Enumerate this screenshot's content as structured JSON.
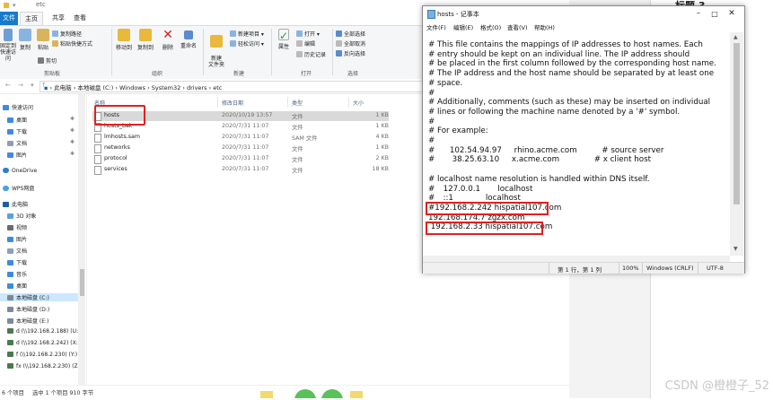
{
  "explorer": {
    "title": "etc",
    "tabs": [
      "文件",
      "主页",
      "共享",
      "查看"
    ],
    "ribbon": {
      "pin_label": "固定到快速访问",
      "copy": "复制",
      "paste": "粘贴",
      "copy_path": "复制路径",
      "paste_shortcut": "粘贴快捷方式",
      "cut": "剪切",
      "move_to": "移动到",
      "copy_to": "复制到",
      "delete": "删除",
      "rename": "重命名",
      "new_folder": "新建\n文件夹",
      "new_item": "新建项目",
      "easy_access": "轻松访问",
      "properties": "属性",
      "open": "打开",
      "edit": "编辑",
      "history": "历史记录",
      "select_all": "全部选择",
      "select_none": "全部取消",
      "invert_select": "反向选择",
      "groups": [
        "剪贴板",
        "组织",
        "新建",
        "打开",
        "选择"
      ]
    },
    "breadcrumbs": [
      "此电脑",
      "本地磁盘 (C:)",
      "Windows",
      "System32",
      "drivers",
      "etc"
    ],
    "nav": [
      {
        "label": "快速访问"
      },
      {
        "label": "桌面"
      },
      {
        "label": "下载"
      },
      {
        "label": "文档"
      },
      {
        "label": "图片"
      },
      {
        "label": "OneDrive"
      },
      {
        "label": "WPS网盘"
      },
      {
        "label": "此电脑"
      },
      {
        "label": "3D 对象"
      },
      {
        "label": "视频"
      },
      {
        "label": "图片"
      },
      {
        "label": "文档"
      },
      {
        "label": "下载"
      },
      {
        "label": "音乐"
      },
      {
        "label": "桌面"
      },
      {
        "label": "本地磁盘 (C:)"
      },
      {
        "label": "本地磁盘 (D:)"
      },
      {
        "label": "本地磁盘 (E:)"
      },
      {
        "label": "d (\\\\192.168.2.188) (U:"
      },
      {
        "label": "d (\\\\192.168.2.242) (X:"
      },
      {
        "label": "f (\\\\192.168.2.230) (Y:)"
      },
      {
        "label": "fx (\\\\192.168.2.230) (Z:"
      }
    ],
    "columns": [
      "名称",
      "修改日期",
      "类型",
      "大小"
    ],
    "files": [
      {
        "name": "hosts",
        "date": "2020/10/19 13:57",
        "type": "文件",
        "size": "1 KB"
      },
      {
        "name": "hosts_bak",
        "date": "2020/7/31 11:07",
        "type": "文件",
        "size": "1 KB"
      },
      {
        "name": "lmhosts.sam",
        "date": "2020/7/31 11:07",
        "type": "SAM 文件",
        "size": "4 KB"
      },
      {
        "name": "networks",
        "date": "2020/7/31 11:07",
        "type": "文件",
        "size": "1 KB"
      },
      {
        "name": "protocol",
        "date": "2020/7/31 11:07",
        "type": "文件",
        "size": "2 KB"
      },
      {
        "name": "services",
        "date": "2020/7/31 11:07",
        "type": "文件",
        "size": "18 KB"
      }
    ],
    "status": {
      "count": "6 个项目",
      "selected": "选中 1 个项目 910 字节"
    }
  },
  "notepad": {
    "title": "hosts - 记事本",
    "menu": [
      "文件(F)",
      "编辑(E)",
      "格式(O)",
      "查看(V)",
      "帮助(H)"
    ],
    "lines": [
      "# This file contains the mappings of IP addresses to host names. Each",
      "# entry should be kept on an individual line. The IP address should",
      "# be placed in the first column followed by the corresponding host name.",
      "# The IP address and the host name should be separated by at least one",
      "# space.",
      "#",
      "# Additionally, comments (such as these) may be inserted on individual",
      "# lines or following the machine name denoted by a '#' symbol.",
      "#",
      "# For example:",
      "#",
      "#      102.54.94.97     rhino.acme.com          # source server",
      "#       38.25.63.10     x.acme.com              # x client host",
      "",
      "# localhost name resolution is handled within DNS itself.",
      "#\t127.0.0.1       localhost",
      "#\t::1             localhost",
      "#192.168.2.242 hispatial107.com",
      "192.168.174.7 zgzx.com",
      " 192.168.2.33 hispatial107.com"
    ],
    "status": {
      "position": "第 1 行，第 1 列",
      "zoom": "100%",
      "eol": "Windows (CRLF)",
      "encoding": "UTF-8"
    }
  },
  "rightdoc": {
    "heading": "标题 3"
  },
  "watermark": "CSDN @橙橙子_52",
  "colors": {
    "accent": "#1979ca",
    "highlight": "#e02020",
    "selection": "#cce8ff"
  }
}
